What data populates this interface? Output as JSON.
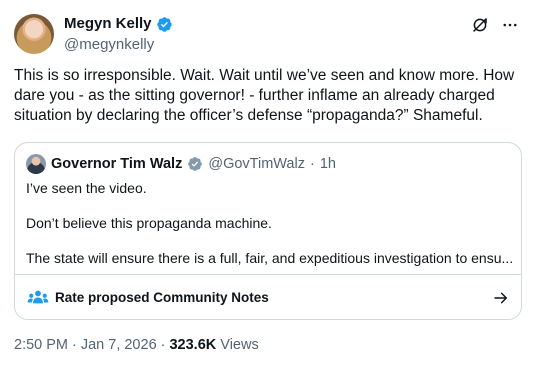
{
  "author": {
    "display_name": "Megyn Kelly",
    "handle": "@megynkelly"
  },
  "tweet": {
    "text": "This is so irresponsible. Wait. Wait until we’ve seen and know more. How dare you - as the sitting governor! - further inflame an already charged situation by declaring the officer’s defense “propaganda?” Shameful."
  },
  "quote": {
    "display_name": "Governor Tim Walz",
    "handle": "@GovTimWalz",
    "separator": "·",
    "age": "1h",
    "paragraphs": [
      "I’ve seen the video.",
      "Don’t believe this propaganda machine.",
      "The state will ensure there is a full, fair, and expeditious investigation to ensu..."
    ]
  },
  "community_notes": {
    "label": "Rate proposed Community Notes"
  },
  "meta": {
    "time": "2:50 PM",
    "sep1": "·",
    "date": "Jan 7, 2026",
    "sep2": "·",
    "views_count": "323.6K",
    "views_label": "Views"
  },
  "colors": {
    "verified": "#1d9bf0",
    "community_notes_icon": "#1d9bf0",
    "secondary_text": "#536471",
    "border": "#cfd9de"
  },
  "icons": {
    "verified": "verified-badge-icon",
    "grok": "grok-icon",
    "more": "more-icon",
    "community_notes": "people-icon",
    "arrow": "arrow-right-icon"
  }
}
